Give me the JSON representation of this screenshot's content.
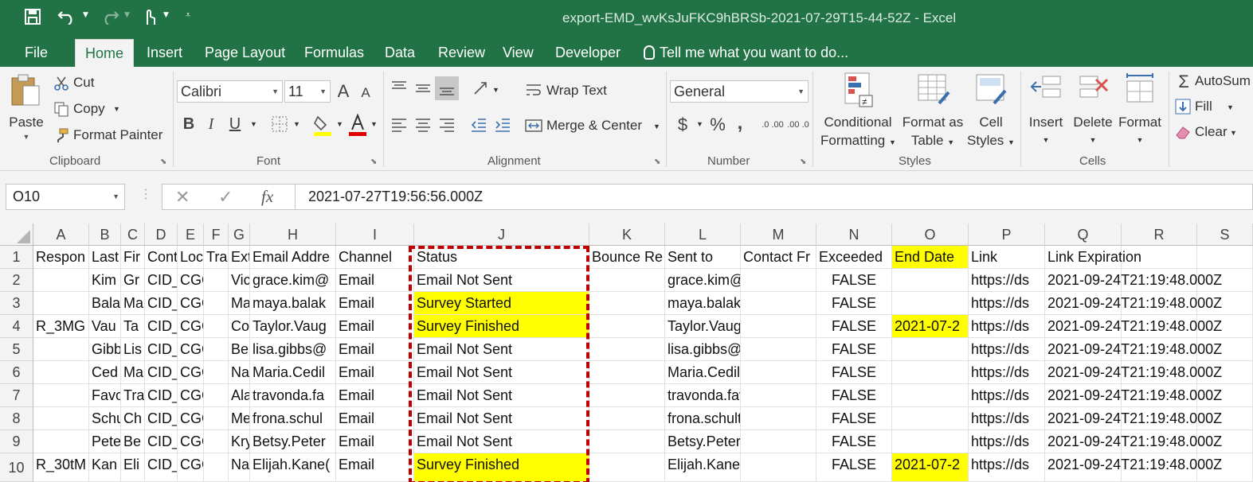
{
  "window": {
    "title": "export-EMD_wvKsJuFKC9hBRSb-2021-07-29T15-44-52Z - Excel"
  },
  "quick_access": {
    "save_icon": "save-icon",
    "undo_icon": "undo-icon",
    "redo_icon": "redo-icon",
    "touch_icon": "touch-mode-icon",
    "customize_icon": "customize-qat-icon"
  },
  "tabs": [
    "File",
    "Home",
    "Insert",
    "Page Layout",
    "Formulas",
    "Data",
    "Review",
    "View",
    "Developer"
  ],
  "tell_me": "Tell me what you want to do...",
  "ribbon": {
    "clipboard": {
      "paste": "Paste",
      "cut": "Cut",
      "copy": "Copy",
      "format_painter": "Format Painter",
      "group": "Clipboard"
    },
    "font": {
      "name": "Calibri",
      "size": "11",
      "group": "Font",
      "bold": "B",
      "italic": "I",
      "underline": "U",
      "grow": "A",
      "shrink": "A"
    },
    "alignment": {
      "wrap_text": "Wrap Text",
      "merge_center": "Merge & Center",
      "group": "Alignment"
    },
    "number": {
      "format": "General",
      "currency": "$",
      "percent": "%",
      "comma": ",",
      "inc_decimal": ".0 .00",
      "dec_decimal": ".00 .0",
      "group": "Number"
    },
    "styles": {
      "conditional_1": "Conditional",
      "conditional_2": "Formatting",
      "format_table_1": "Format as",
      "format_table_2": "Table",
      "cell_styles_1": "Cell",
      "cell_styles_2": "Styles",
      "group": "Styles"
    },
    "cells": {
      "insert": "Insert",
      "delete": "Delete",
      "format": "Format",
      "group": "Cells"
    },
    "editing": {
      "autosum": "AutoSum",
      "fill": "Fill",
      "clear": "Clear"
    }
  },
  "formula_bar": {
    "name_box": "O10",
    "fx": "fx",
    "value": "2021-07-27T19:56:56.000Z"
  },
  "sheet": {
    "columns": [
      "A",
      "B",
      "C",
      "D",
      "E",
      "F",
      "G",
      "H",
      "I",
      "J",
      "K",
      "L",
      "M",
      "N",
      "O",
      "P",
      "Q",
      "R",
      "S"
    ],
    "rows": [
      [
        "Respon",
        "Last",
        "Fir",
        "Cont",
        "Loc",
        "Tra",
        "Ext",
        "Email Addre",
        "Channel",
        "Status",
        "Bounce Re",
        "Sent to",
        "Contact Fr",
        "Exceeded",
        "End Date",
        "Link",
        "Link Expiration"
      ],
      [
        "",
        "Kim",
        "Gr",
        "CID_",
        "CGC_Il",
        "",
        "Vic",
        "grace.kim@",
        "Email",
        "Email Not Sent",
        "",
        "grace.kim@sciencear",
        "",
        "FALSE",
        "",
        "https://ds",
        "2021-09-24T21:19:48.000Z"
      ],
      [
        "",
        "Bala",
        "Ma",
        "CID_",
        "CGC_F",
        "",
        "Ma",
        "maya.balak",
        "Email",
        "Survey Started",
        "",
        "maya.balakier@scier",
        "",
        "FALSE",
        "",
        "https://ds",
        "2021-09-24T21:19:48.000Z"
      ],
      [
        "R_3MG",
        "Vau",
        "Ta",
        "CID_",
        "CGC_a",
        "",
        "Co",
        "Taylor.Vaug",
        "Email",
        "Survey Finished",
        "",
        "Taylor.Vaughn@scien",
        "",
        "FALSE",
        "2021-07-2",
        "https://ds",
        "2021-09-24T21:19:48.000Z"
      ],
      [
        "",
        "Gibb",
        "Lis",
        "CID_",
        "CGC_G",
        "",
        "Be",
        "lisa.gibbs@",
        "Email",
        "Email Not Sent",
        "",
        "lisa.gibbs@sciencear",
        "",
        "FALSE",
        "",
        "https://ds",
        "2021-09-24T21:19:48.000Z"
      ],
      [
        "",
        "Ced",
        "Ma",
        "CID_",
        "CGC_f",
        "",
        "Na",
        "Maria.Cedil",
        "Email",
        "Email Not Sent",
        "",
        "Maria.Cedillio@scier",
        "",
        "FALSE",
        "",
        "https://ds",
        "2021-09-24T21:19:48.000Z"
      ],
      [
        "",
        "Favo",
        "Tra",
        "CID_",
        "CGC_r",
        "",
        "Ala",
        "travonda.fa",
        "Email",
        "Email Not Sent",
        "",
        "travonda.favorite@s",
        "",
        "FALSE",
        "",
        "https://ds",
        "2021-09-24T21:19:48.000Z"
      ],
      [
        "",
        "Schu",
        "Ch",
        "CID_",
        "CGC_c",
        "",
        "Me",
        "frona.schul",
        "Email",
        "Email Not Sent",
        "",
        "frona.schultz@scienc",
        "",
        "FALSE",
        "",
        "https://ds",
        "2021-09-24T21:19:48.000Z"
      ],
      [
        "",
        "Pete",
        "Be",
        "CID_",
        "CGC_E",
        "",
        "Kry",
        "Betsy.Peter",
        "Email",
        "Email Not Sent",
        "",
        "Betsy.Peterson@scie",
        "",
        "FALSE",
        "",
        "https://ds",
        "2021-09-24T21:19:48.000Z"
      ],
      [
        "R_30tM",
        "Kan",
        "Eli",
        "CID_",
        "CGC_g",
        "",
        "Na",
        "Elijah.Kane(",
        "Email",
        "Survey Finished",
        "",
        "Elijah.Kane@sciences",
        "",
        "FALSE",
        "2021-07-2",
        "https://ds",
        "2021-09-24T21:19:48.000Z"
      ]
    ],
    "highlight_color": "#ffff00",
    "selection_color": "#c00000"
  },
  "colors": {
    "brand": "#217346",
    "ribbon_bg": "#f3f3f3"
  }
}
